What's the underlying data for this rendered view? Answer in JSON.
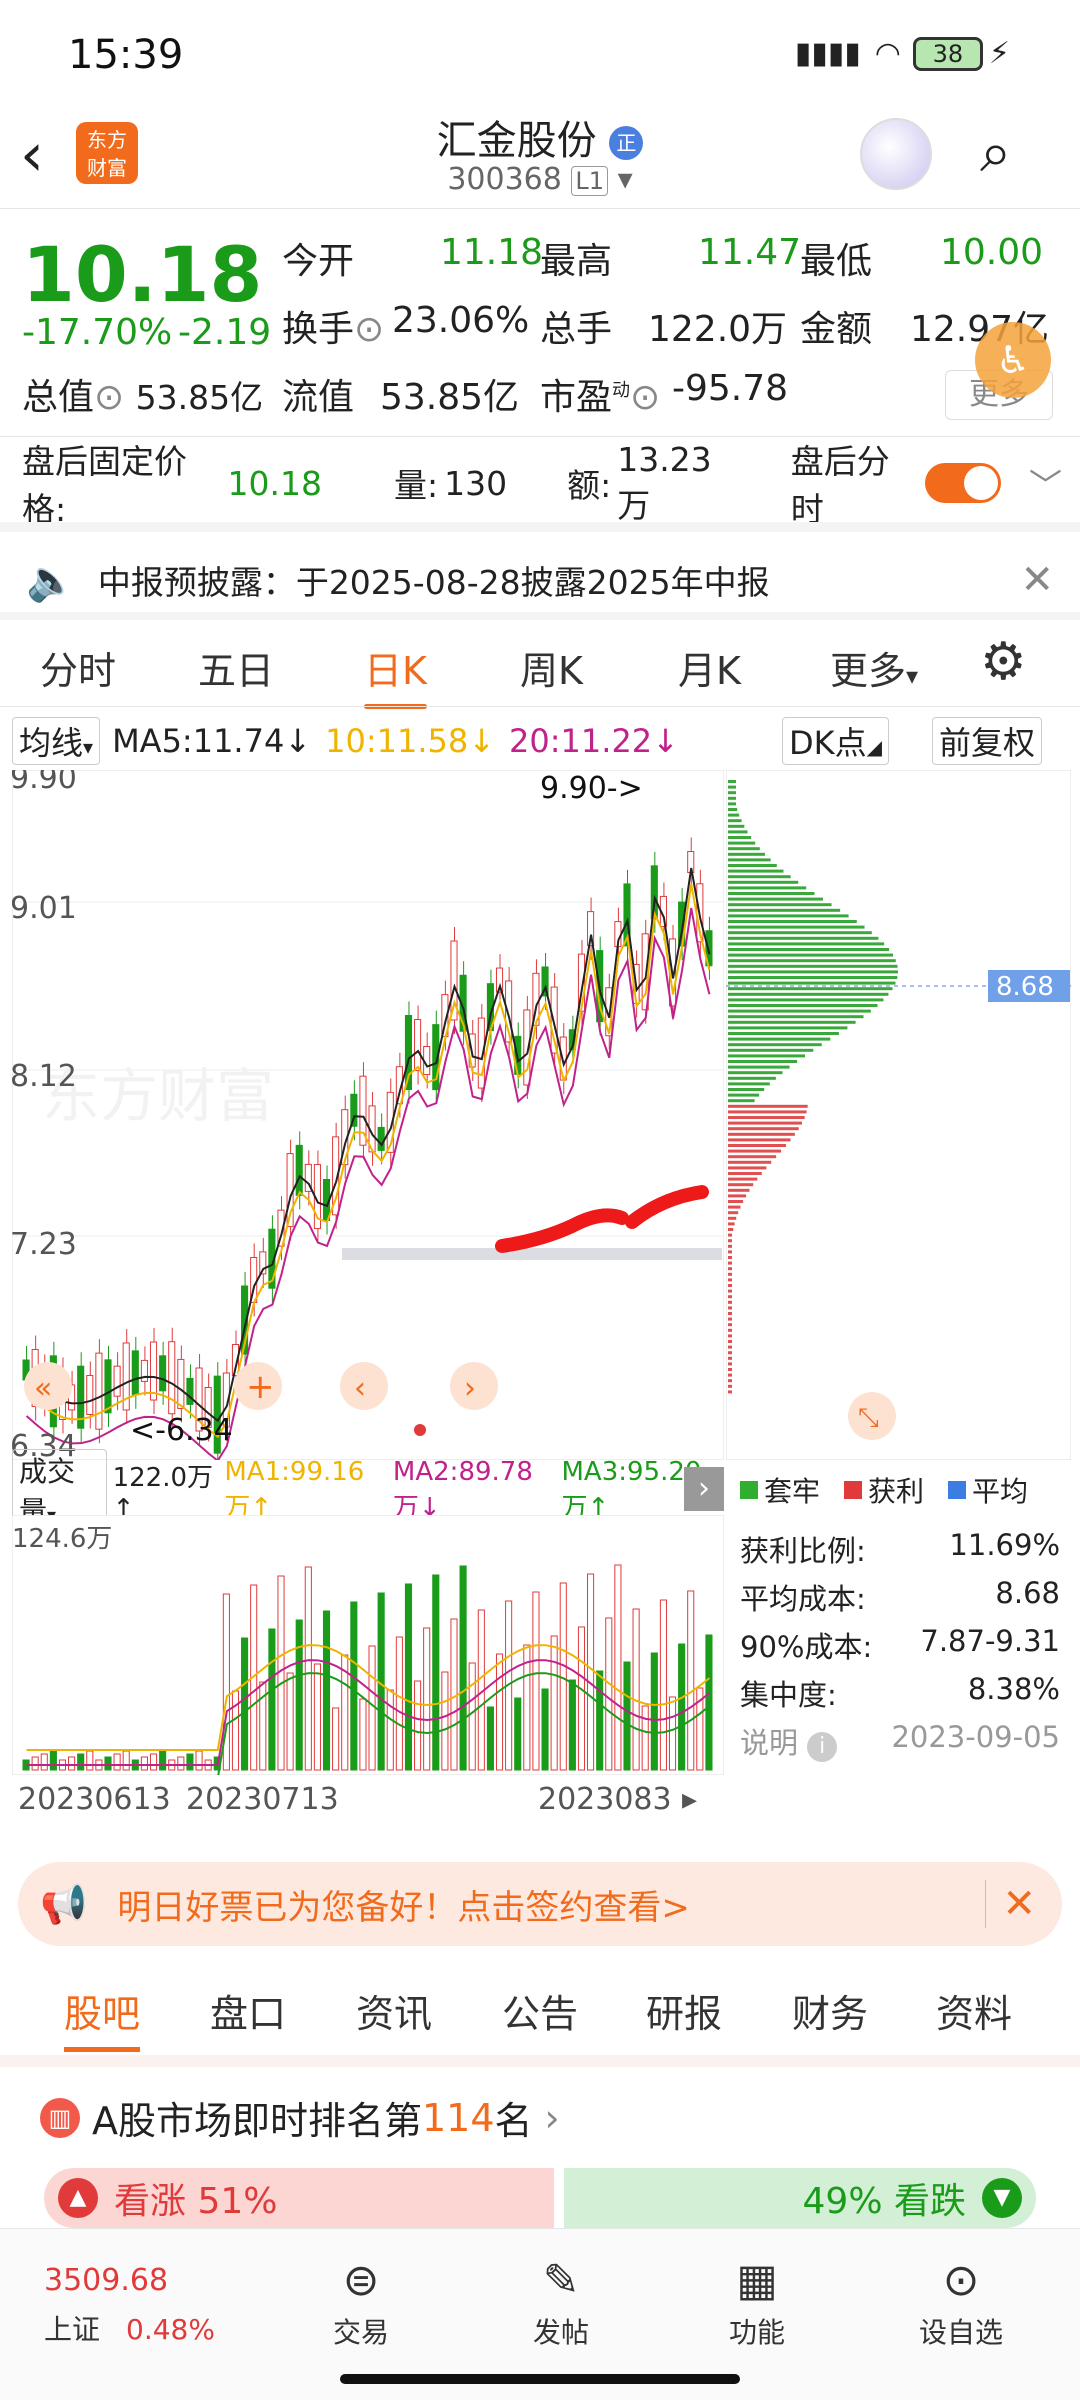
{
  "status": {
    "time": "15:39",
    "battery": "38"
  },
  "header": {
    "logo_line1": "东方",
    "logo_line2": "财富",
    "stock_name": "汇金股份",
    "badge": "正",
    "code": "300368",
    "level": "L1"
  },
  "quote": {
    "price": "10.18",
    "change_pct": "-17.70%",
    "change": "-2.19",
    "open_label": "今开",
    "open": "11.18",
    "high_label": "最高",
    "high": "11.47",
    "low_label": "最低",
    "low": "10.00",
    "turnover_label": "换手",
    "turnover": "23.06%",
    "volume_label": "总手",
    "volume": "122.0万",
    "amount_label": "金额",
    "amount": "12.97亿",
    "mktcap_label": "总值",
    "mktcap": "53.85亿",
    "float_label": "流值",
    "float": "53.85亿",
    "pe_label": "市盈",
    "pe_sup": "动",
    "pe": "-95.78",
    "more": "更多"
  },
  "afterhours": {
    "label": "盘后固定价格:",
    "price": "10.18",
    "vol_label": "量:",
    "vol": "130",
    "amt_label": "额:",
    "amt": "13.23万",
    "toggle_label": "盘后分时"
  },
  "notice": {
    "text": "中报预披露：于2025-08-28披露2025年中报"
  },
  "chart_tabs": [
    "分时",
    "五日",
    "日K",
    "周K",
    "月K",
    "更多"
  ],
  "ma": {
    "selector": "均线",
    "ma5": "MA5:11.74",
    "ma10": "10:11.58",
    "ma20": "20:11.22",
    "dk": "DK点",
    "adj": "前复权"
  },
  "kchart_labels": {
    "y1": "9.90",
    "y2": "9.01",
    "y3": "8.12",
    "y4": "7.23",
    "y5": "6.34",
    "high_mark": "9.90->",
    "low_mark": "<-6.34",
    "chip_price": "8.68"
  },
  "volume": {
    "selector": "成交量",
    "v": "122.0万↑",
    "ma1": "MA1:99.16万↑",
    "ma2": "MA2:89.78万↓",
    "ma3": "MA3:95.20万↑",
    "max": "124.6万"
  },
  "dates": {
    "d1": "20230613",
    "d2": "20230713",
    "d3": "2023083"
  },
  "chip_panel": {
    "legend": [
      "套牢",
      "获利",
      "平均"
    ],
    "profit_label": "获利比例:",
    "profit": "11.69%",
    "avg_label": "平均成本:",
    "avg": "8.68",
    "range_label": "90%成本:",
    "range": "7.87-9.31",
    "conc_label": "集中度:",
    "conc": "8.38%",
    "note_label": "说明",
    "date": "2023-09-05"
  },
  "promo": {
    "text": "明日好票已为您备好！点击签约查看>"
  },
  "bottom_tabs": [
    "股吧",
    "盘口",
    "资讯",
    "公告",
    "研报",
    "财务",
    "资料"
  ],
  "rank": {
    "prefix": "A股市场即时排名第",
    "num": "114",
    "suffix": "名"
  },
  "sentiment": {
    "up": "看涨 51%",
    "down": "49% 看跌"
  },
  "nav": {
    "index_value": "3509.68",
    "index_name": "上证",
    "index_change": "0.48%",
    "trade": "交易",
    "post": "发帖",
    "func": "功能",
    "watch": "设自选"
  },
  "colors": {
    "accent": "#f26a1b",
    "down": "#1a9b1a",
    "up": "#e03a3a",
    "ma10": "#f0b400",
    "ma20": "#c0228c"
  },
  "chart_data": {
    "type": "candlestick",
    "ylim": [
      6.34,
      9.9
    ],
    "ma5": 11.74,
    "ma10": 11.58,
    "ma20": 11.22
  }
}
